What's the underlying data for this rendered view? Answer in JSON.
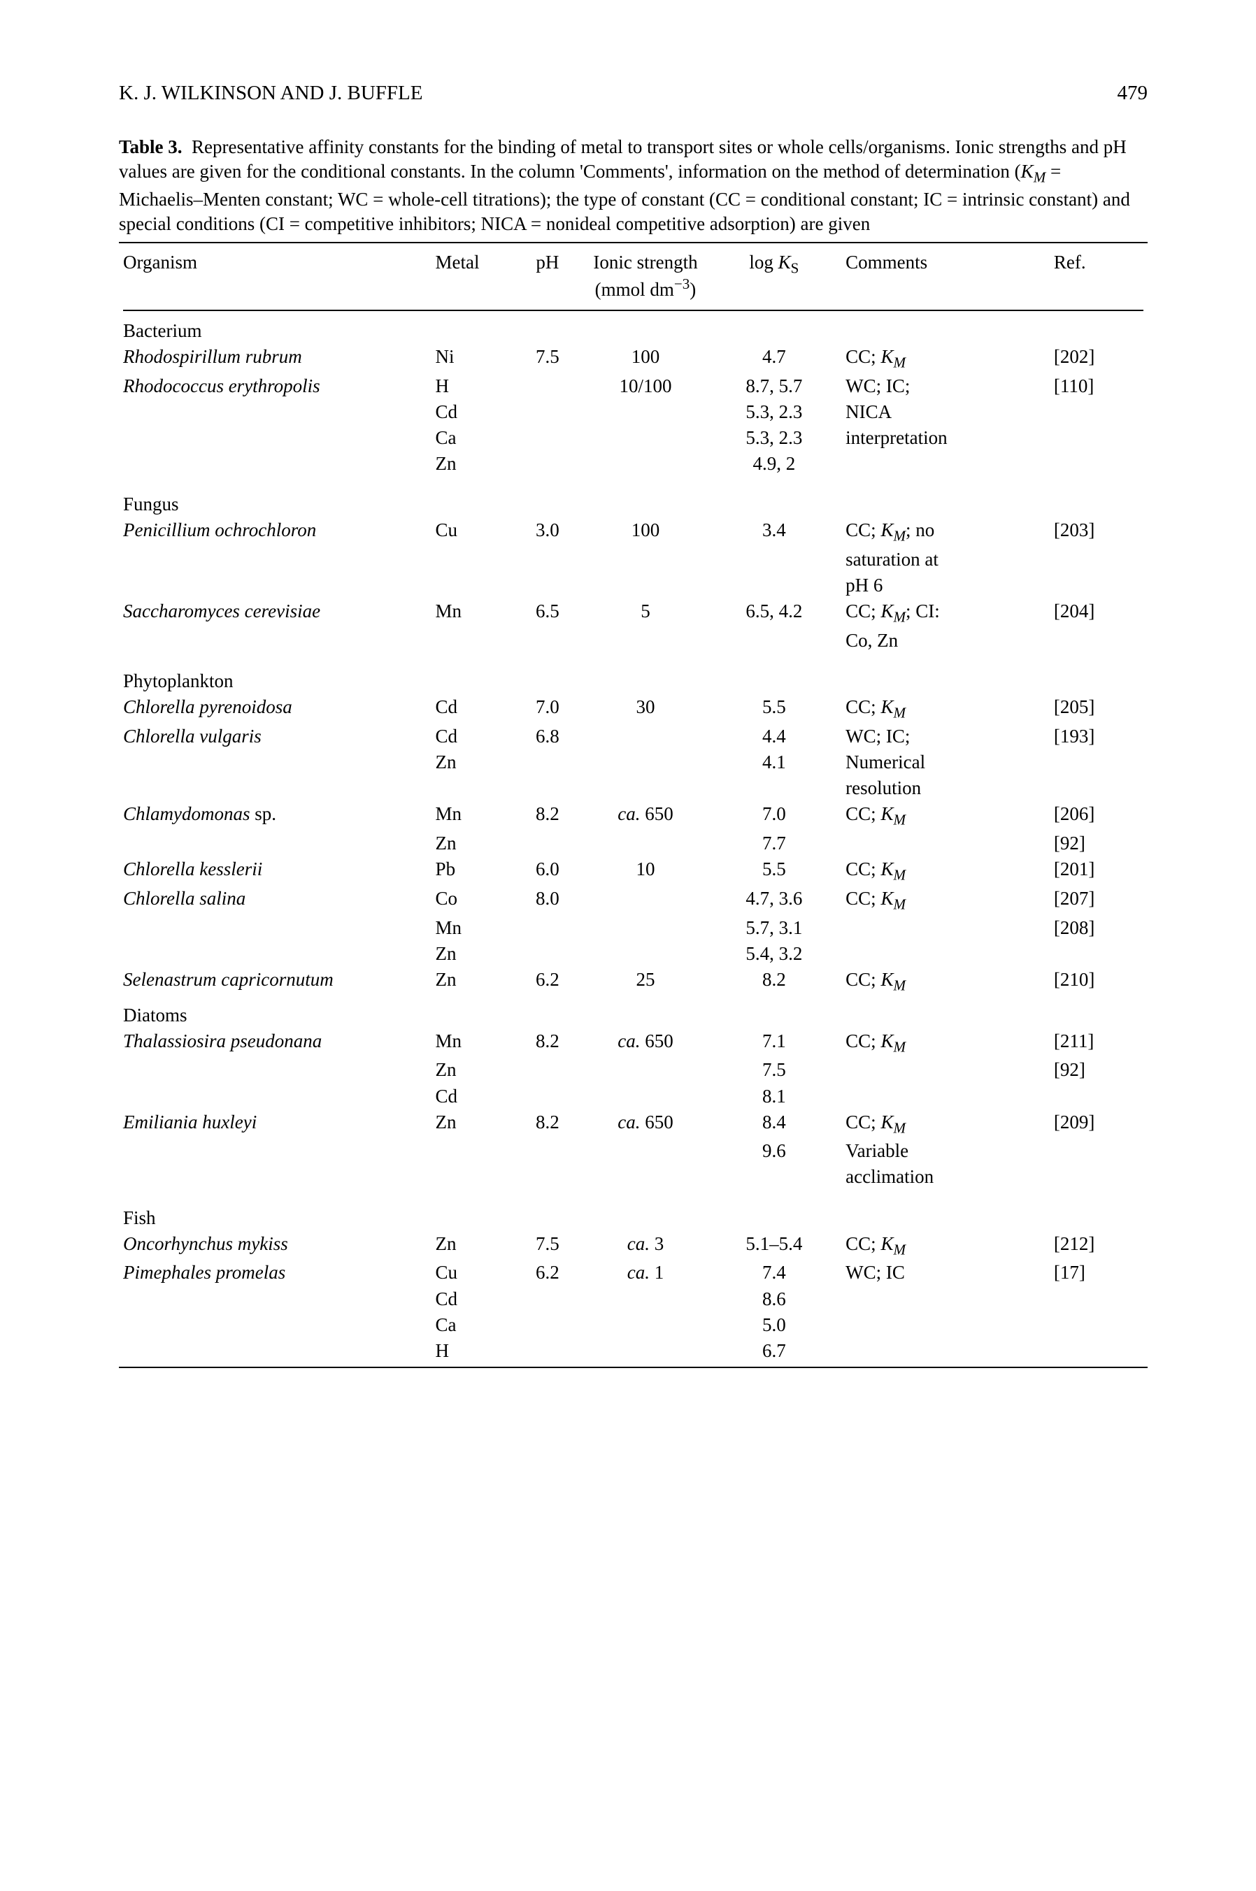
{
  "header": {
    "authors": "K. J. WILKINSON AND J. BUFFLE",
    "page": "479"
  },
  "caption": {
    "label": "Table 3.",
    "text_line1": "Representative affinity constants for the binding of metal to transport sites or whole cells/organisms. Ionic strengths and pH values are given for the conditional constants. In the column 'Comments', information on the method of determination (",
    "km_def": " = Michaelis–Menten constant; WC = whole-cell titrations); the type of constant (CC = conditional constant; IC = intrinsic constant) and special conditions (CI = competitive inhibitors; NICA = nonideal competitive adsorption) are given"
  },
  "columns": {
    "organism": "Organism",
    "metal": "Metal",
    "ph": "pH",
    "ionic": "Ionic strength (mmol dm",
    "ionic_exp": "−3",
    "ionic_close": ")",
    "logks_a": "log ",
    "logks_b": "K",
    "logks_sub": "S",
    "comments": "Comments",
    "ref": "Ref."
  },
  "sections": {
    "bacterium": "Bacterium",
    "fungus": "Fungus",
    "phytoplankton": "Phytoplankton",
    "diatoms": "Diatoms",
    "fish": "Fish"
  },
  "rows": {
    "r1": {
      "org": "Rhodospirillum rubrum",
      "metal": "Ni",
      "ph": "7.5",
      "ionic": "100",
      "logks": "4.7",
      "comments_a": "CC; ",
      "ref": "[202]"
    },
    "r2": {
      "org": "Rhodococcus erythropolis",
      "metal": "H",
      "ionic": "10/100",
      "logks": "8.7, 5.7",
      "comments": "WC; IC;",
      "ref": "[110]"
    },
    "r2b": {
      "metal": "Cd",
      "logks": "5.3, 2.3",
      "comments": "NICA"
    },
    "r2c": {
      "metal": "Ca",
      "logks": "5.3, 2.3",
      "comments": "interpretation"
    },
    "r2d": {
      "metal": "Zn",
      "logks": "4.9, 2"
    },
    "r3": {
      "org": "Penicillium ochrochloron",
      "metal": "Cu",
      "ph": "3.0",
      "ionic": "100",
      "logks": "3.4",
      "comments_a": "CC; ",
      "comments_b": "; no",
      "ref": "[203]"
    },
    "r3b": {
      "comments": "saturation at"
    },
    "r3c": {
      "comments": "pH 6"
    },
    "r4": {
      "org": "Saccharomyces cerevisiae",
      "metal": "Mn",
      "ph": "6.5",
      "ionic": "5",
      "logks": "6.5, 4.2",
      "comments_a": "CC; ",
      "comments_b": "; CI:",
      "ref": "[204]"
    },
    "r4b": {
      "comments": "Co, Zn"
    },
    "r5": {
      "org": "Chlorella pyrenoidosa",
      "metal": "Cd",
      "ph": "7.0",
      "ionic": "30",
      "logks": "5.5",
      "comments_a": "CC; ",
      "ref": "[205]"
    },
    "r6": {
      "org": "Chlorella vulgaris",
      "metal": "Cd",
      "ph": "6.8",
      "logks": "4.4",
      "comments": "WC; IC;",
      "ref": "[193]"
    },
    "r6b": {
      "metal": "Zn",
      "logks": "4.1",
      "comments": "Numerical"
    },
    "r6c": {
      "comments": "resolution"
    },
    "r7": {
      "org": "Chlamydomonas",
      "sp": " sp.",
      "metal": "Mn",
      "ph": "8.2",
      "ionic_a": "ca.",
      "ionic_b": " 650",
      "logks": "7.0",
      "comments_a": "CC; ",
      "ref": "[206]"
    },
    "r7b": {
      "metal": "Zn",
      "logks": "7.7",
      "ref": "[92]"
    },
    "r8": {
      "org": "Chlorella kesslerii",
      "metal": "Pb",
      "ph": "6.0",
      "ionic": "10",
      "logks": "5.5",
      "comments_a": "CC; ",
      "ref": "[201]"
    },
    "r9": {
      "org": "Chlorella salina",
      "metal": "Co",
      "ph": "8.0",
      "logks": "4.7, 3.6",
      "comments_a": "CC; ",
      "ref": "[207]"
    },
    "r9b": {
      "metal": "Mn",
      "logks": "5.7, 3.1",
      "ref": "[208]"
    },
    "r9c": {
      "metal": "Zn",
      "logks": "5.4, 3.2"
    },
    "r10": {
      "org": "Selenastrum capricornutum",
      "metal": "Zn",
      "ph": "6.2",
      "ionic": "25",
      "logks": "8.2",
      "comments_a": "CC; ",
      "ref": "[210]"
    },
    "r11": {
      "org": "Thalassiosira pseudonana",
      "metal": "Mn",
      "ph": "8.2",
      "ionic_a": "ca.",
      "ionic_b": " 650",
      "logks": "7.1",
      "comments_a": "CC; ",
      "ref": "[211]"
    },
    "r11b": {
      "metal": "Zn",
      "logks": "7.5",
      "ref": "[92]"
    },
    "r11c": {
      "metal": "Cd",
      "logks": "8.1"
    },
    "r12": {
      "org": "Emiliania huxleyi",
      "metal": "Zn",
      "ph": "8.2",
      "ionic_a": "ca.",
      "ionic_b": " 650",
      "logks": "8.4",
      "comments_a": "CC; ",
      "ref": "[209]"
    },
    "r12b": {
      "logks": "9.6",
      "comments": "Variable"
    },
    "r12c": {
      "comments": "acclimation"
    },
    "r13": {
      "org": "Oncorhynchus mykiss",
      "metal": "Zn",
      "ph": "7.5",
      "ionic_a": "ca.",
      "ionic_b": " 3",
      "logks": "5.1–5.4",
      "comments_a": "CC; ",
      "ref": "[212]"
    },
    "r14": {
      "org": "Pimephales promelas",
      "metal": "Cu",
      "ph": "6.2",
      "ionic_a": "ca.",
      "ionic_b": " 1",
      "logks": "7.4",
      "comments": "WC; IC",
      "ref": "[17]"
    },
    "r14b": {
      "metal": "Cd",
      "logks": "8.6"
    },
    "r14c": {
      "metal": "Ca",
      "logks": "5.0"
    },
    "r14d": {
      "metal": "H",
      "logks": "6.7"
    }
  },
  "km_label_k": "K",
  "km_label_m": "M"
}
